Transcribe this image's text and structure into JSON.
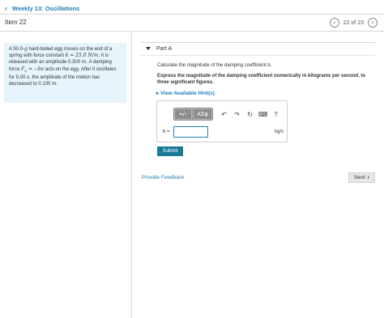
{
  "nav": {
    "back_label": "Weekly 13: Oscillations",
    "back_icon": "chevron-left-icon"
  },
  "header": {
    "item_title": "Item 22",
    "prev_icon": "chevron-left-icon",
    "next_icon": "chevron-right-icon",
    "counter": "22 of 23"
  },
  "problem": {
    "t1": "A 50.0-",
    "m1": "g",
    "t2": " hard-boiled egg moves on the end of a spring with force constant ",
    "m2": "k = 25.0 N/m",
    "t3": ". It is released with an amplitude 0.300 ",
    "m3": "m",
    "t4": ". A damping force ",
    "m4": "F",
    "m4sub": "x",
    "m5": " = −bv",
    "t5": " acts on the egg. After it oscillates for 5.00 ",
    "m6": "s",
    "t6": ", the amplitude of the motion has decreased to 0.100 ",
    "m7": "m",
    "t7": "."
  },
  "part": {
    "label": "Part A",
    "question": "Calculate the magnitude of the damping coefficient b.",
    "instruction": "Express the magnitude of the damping coefficient numerically in kilograms per second, to three significant figures.",
    "hint_label": "View Available Hint(s)"
  },
  "toolbar": {
    "templates_label": "▪√▫",
    "greek_label": "ΑΣφ",
    "undo_icon": "undo-icon",
    "redo_icon": "redo-icon",
    "reset_icon": "reset-icon",
    "keyboard_icon": "keyboard-icon",
    "help_label": "?"
  },
  "answer": {
    "variable_label": "b =",
    "value": "",
    "unit": "kg/s"
  },
  "buttons": {
    "submit": "Submit",
    "provide_feedback": "Provide Feedback",
    "next": "Next"
  },
  "colors": {
    "link": "#1e7bb8",
    "problem_bg": "#e6f4fb",
    "submit_bg": "#1a7b99",
    "toolbar_bg": "#8d8d8d"
  }
}
